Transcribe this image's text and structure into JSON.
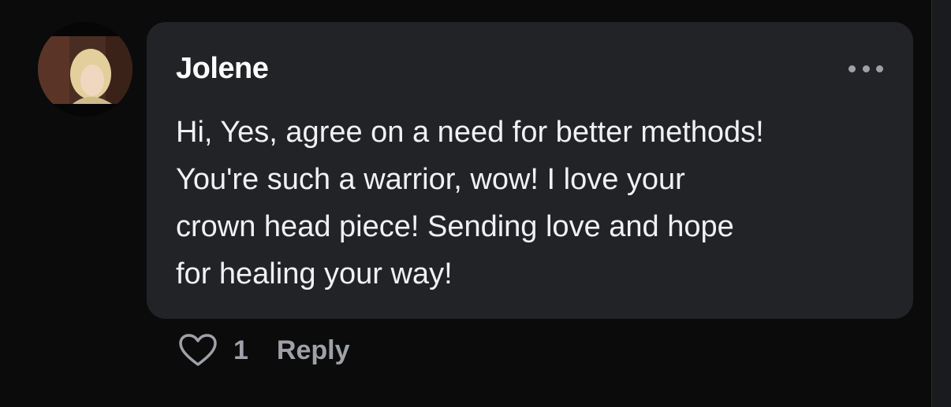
{
  "comment": {
    "author": "Jolene",
    "lines": [
      "Hi, Yes, agree on a need for better methods!",
      "You're such a warrior, wow! I love your",
      "crown head piece! Sending love and hope",
      "for healing your way!"
    ],
    "likes": "1",
    "reply_label": "Reply"
  },
  "icons": {
    "like": "heart-icon",
    "more": "more-options-icon",
    "avatar": "user-avatar"
  },
  "colors": {
    "background": "#0b0b0c",
    "bubble": "#222326",
    "text": "#f1f1f3",
    "muted": "#9ea1a8"
  }
}
